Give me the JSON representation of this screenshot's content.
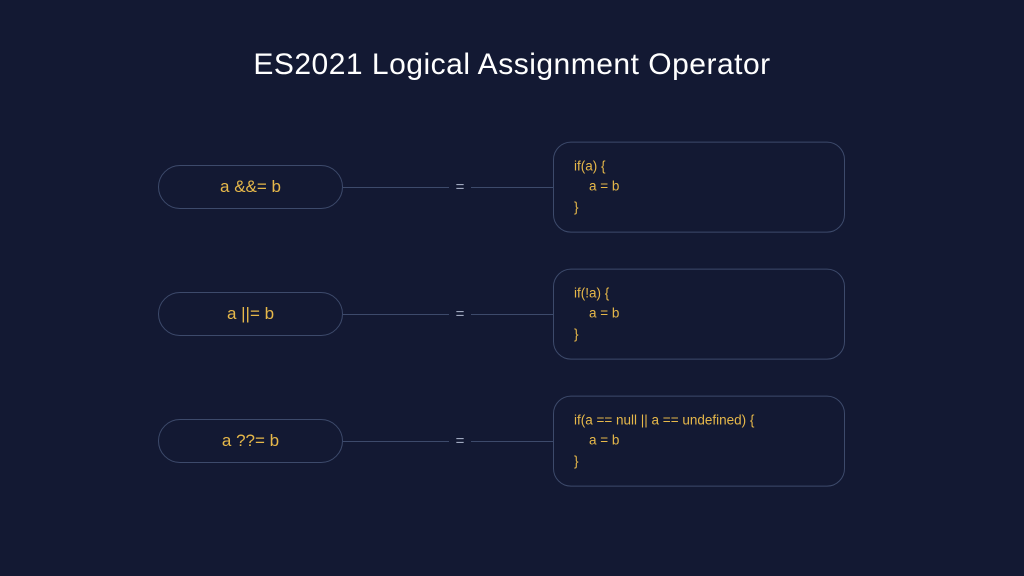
{
  "title": "ES2021 Logical Assignment Operator",
  "rows": [
    {
      "operator": "a &&= b",
      "equals": "=",
      "equivalent": "if(a) {\n    a = b\n}"
    },
    {
      "operator": "a ||= b",
      "equals": "=",
      "equivalent": "if(!a) {\n    a = b\n}"
    },
    {
      "operator": "a ??= b",
      "equals": "=",
      "equivalent": "if(a == null || a == undefined) {\n    a = b\n}"
    }
  ],
  "colors": {
    "background": "#131933",
    "accent": "#e6b84a",
    "border": "#3d4a6b",
    "title": "#ffffff",
    "equals": "#a0a8bf"
  }
}
